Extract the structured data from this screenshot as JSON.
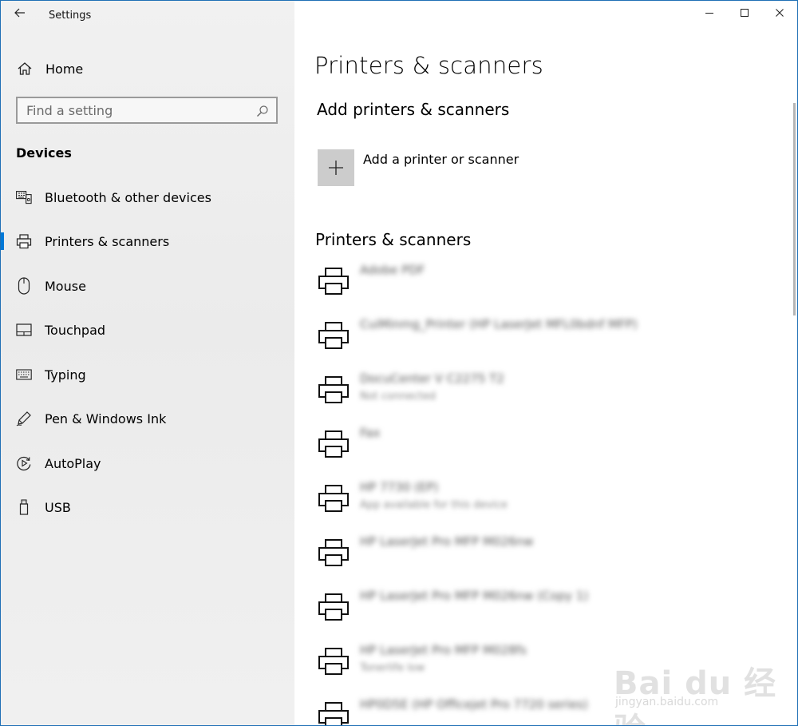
{
  "window": {
    "title": "Settings"
  },
  "sidebar": {
    "home_label": "Home",
    "search_placeholder": "Find a setting",
    "section": "Devices",
    "items": [
      {
        "label": "Bluetooth & other devices",
        "icon": "bluetooth-devices-icon",
        "selected": false
      },
      {
        "label": "Printers & scanners",
        "icon": "printer-icon",
        "selected": true
      },
      {
        "label": "Mouse",
        "icon": "mouse-icon",
        "selected": false
      },
      {
        "label": "Touchpad",
        "icon": "touchpad-icon",
        "selected": false
      },
      {
        "label": "Typing",
        "icon": "keyboard-icon",
        "selected": false
      },
      {
        "label": "Pen & Windows Ink",
        "icon": "pen-icon",
        "selected": false
      },
      {
        "label": "AutoPlay",
        "icon": "autoplay-icon",
        "selected": false
      },
      {
        "label": "USB",
        "icon": "usb-icon",
        "selected": false
      }
    ]
  },
  "main": {
    "page_title": "Printers & scanners",
    "add_section_title": "Add printers & scanners",
    "add_label": "Add a printer or scanner",
    "list_title": "Printers & scanners",
    "printers": [
      {
        "name": "Adobe PDF",
        "status": ""
      },
      {
        "name": "CuiMinmg_Printer (HP LaserJet MFL0bdnf MFP)",
        "status": ""
      },
      {
        "name": "DocuCenter V C2275 T2",
        "status": "Not connected"
      },
      {
        "name": "Fax",
        "status": ""
      },
      {
        "name": "HP 7730 (EP)",
        "status": "App available for this device"
      },
      {
        "name": "HP LaserJet Pro MFP M026nw",
        "status": ""
      },
      {
        "name": "HP LaserJet Pro MFP M026nw (Copy 1)",
        "status": ""
      },
      {
        "name": "HP LaserJet Pro MFP M028fs",
        "status": "Tonerlife low"
      },
      {
        "name": "HP0D5E (HP Officejet Pro 7720 series)",
        "status": ""
      }
    ]
  },
  "watermark": {
    "brand": "Bai du 经验",
    "url": "jingyan.baidu.com"
  },
  "colors": {
    "accent": "#0078d7",
    "sidebar_bg": "#efefef",
    "tile_bg": "#cccccc"
  }
}
